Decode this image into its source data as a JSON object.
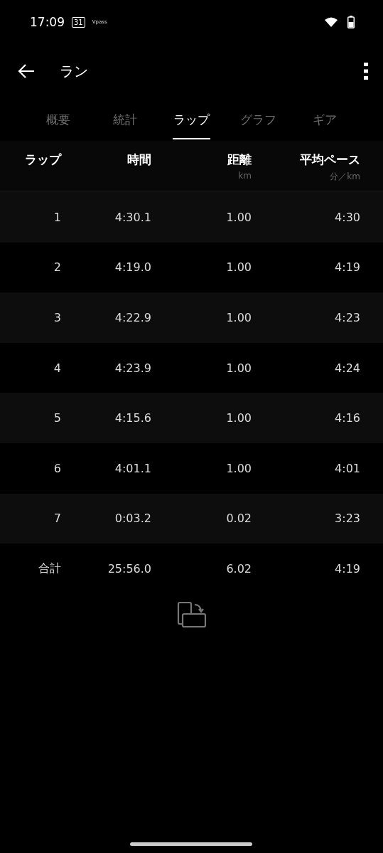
{
  "status_bar": {
    "time": "17:09",
    "calendar_day": "31",
    "notification": "Vpass"
  },
  "app_bar": {
    "title": "ラン"
  },
  "tabs": [
    {
      "label": "概要",
      "selected": false
    },
    {
      "label": "統計",
      "selected": false
    },
    {
      "label": "ラップ",
      "selected": true
    },
    {
      "label": "グラフ",
      "selected": false
    },
    {
      "label": "ギア",
      "selected": false
    }
  ],
  "table": {
    "columns": [
      {
        "label": "ラップ"
      },
      {
        "label": "時間"
      },
      {
        "label": "距離",
        "unit": "km"
      },
      {
        "label": "平均ペース",
        "unit": "分／km"
      }
    ],
    "rows": [
      [
        "1",
        "4:30.1",
        "1.00",
        "4:30"
      ],
      [
        "2",
        "4:19.0",
        "1.00",
        "4:19"
      ],
      [
        "3",
        "4:22.9",
        "1.00",
        "4:23"
      ],
      [
        "4",
        "4:23.9",
        "1.00",
        "4:24"
      ],
      [
        "5",
        "4:15.6",
        "1.00",
        "4:16"
      ],
      [
        "6",
        "4:01.1",
        "1.00",
        "4:01"
      ],
      [
        "7",
        "0:03.2",
        "0.02",
        "3:23"
      ]
    ],
    "total": [
      "合計",
      "25:56.0",
      "6.02",
      "4:19"
    ]
  }
}
